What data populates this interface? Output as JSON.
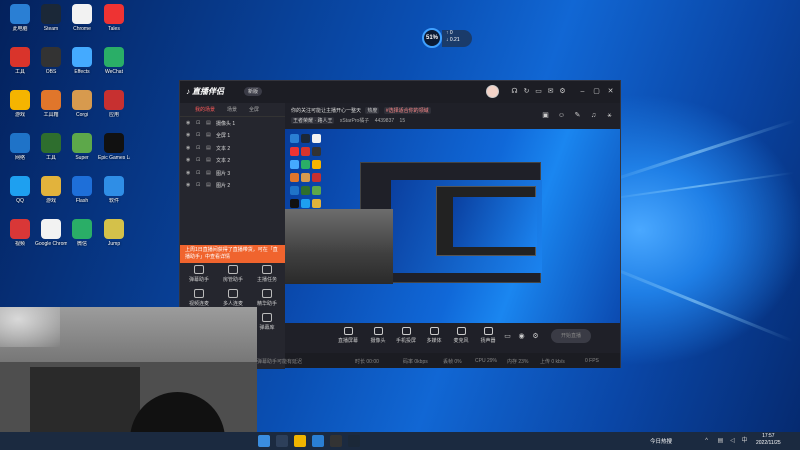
{
  "desktop_icons": [
    {
      "label": "此电脑",
      "color": "#2a7fd4"
    },
    {
      "label": "Steam",
      "color": "#1b2838"
    },
    {
      "label": "Chrome",
      "color": "#f2f2f2"
    },
    {
      "label": "Tales",
      "color": "#e33"
    },
    {
      "label": "工具",
      "color": "#d9342b"
    },
    {
      "label": "OBS",
      "color": "#333"
    },
    {
      "label": "Effects",
      "color": "#44aaff"
    },
    {
      "label": "WeChat",
      "color": "#2aae67"
    },
    {
      "label": "游戏",
      "color": "#f5b400"
    },
    {
      "label": "工具箱",
      "color": "#e0762b"
    },
    {
      "label": "Corgi",
      "color": "#d79a4e"
    },
    {
      "label": "应用",
      "color": "#c73030"
    },
    {
      "label": "网络",
      "color": "#1f73c8"
    },
    {
      "label": "工具",
      "color": "#2e6e2e"
    },
    {
      "label": "Super",
      "color": "#5da84a"
    },
    {
      "label": "Epic Games Launcher",
      "color": "#111"
    },
    {
      "label": "QQ",
      "color": "#1ea0f0"
    },
    {
      "label": "游戏",
      "color": "#e2b33c"
    },
    {
      "label": "Flash",
      "color": "#1e6fd9"
    },
    {
      "label": "软件",
      "color": "#2f8ee6"
    },
    {
      "label": "视频",
      "color": "#d93737"
    },
    {
      "label": "Google Chrome",
      "color": "#f2f2f2"
    },
    {
      "label": "微信",
      "color": "#2aae67"
    },
    {
      "label": "Jump",
      "color": "#d4c14a"
    }
  ],
  "perf": {
    "percent": "51%",
    "up": "0",
    "down": "0.21"
  },
  "app": {
    "logo": "直播伴侣",
    "badge": "新版",
    "left_tabs": [
      "我的场景",
      "场景",
      "全屏"
    ],
    "sources": [
      "摄像头 1",
      "全屏 1",
      "文本 2",
      "文本 2",
      "图片 3",
      "图片 2"
    ],
    "notice": "上周1日直播间获得了直播带货，可在「直播助手」中查看详情",
    "tools": [
      "弹幕助手",
      "房管助手",
      "主播任务",
      "视频连麦",
      "多人连麦",
      "精华助手",
      "弹幕库"
    ],
    "header_line1": "你的关注可能让主播开心一整天",
    "header_tag": "热度",
    "header_pill": "#选择适合你的领域",
    "header_line2_tag": "王者荣耀 · 路人王",
    "header_line2_user": "xStarPro橘子",
    "header_id": "4439837",
    "header_count": "15",
    "bottom_tools": [
      "直播屏幕",
      "摄像头",
      "手机投屏",
      "多媒体",
      "麦克风",
      "扬声器"
    ],
    "go_live": "开始直播",
    "status_items": [
      "时长 00:00",
      "码率 0kbps",
      "丢帧 0%",
      "CPU 29%",
      "内存 23%",
      "上传 0 kb/s",
      "0 FPS"
    ],
    "status_hint": "弹幕助手可能有延迟"
  },
  "taskbar": {
    "weather": "今日热搜",
    "time": "17:57",
    "date": "2022/11/25"
  },
  "chart_data": null
}
